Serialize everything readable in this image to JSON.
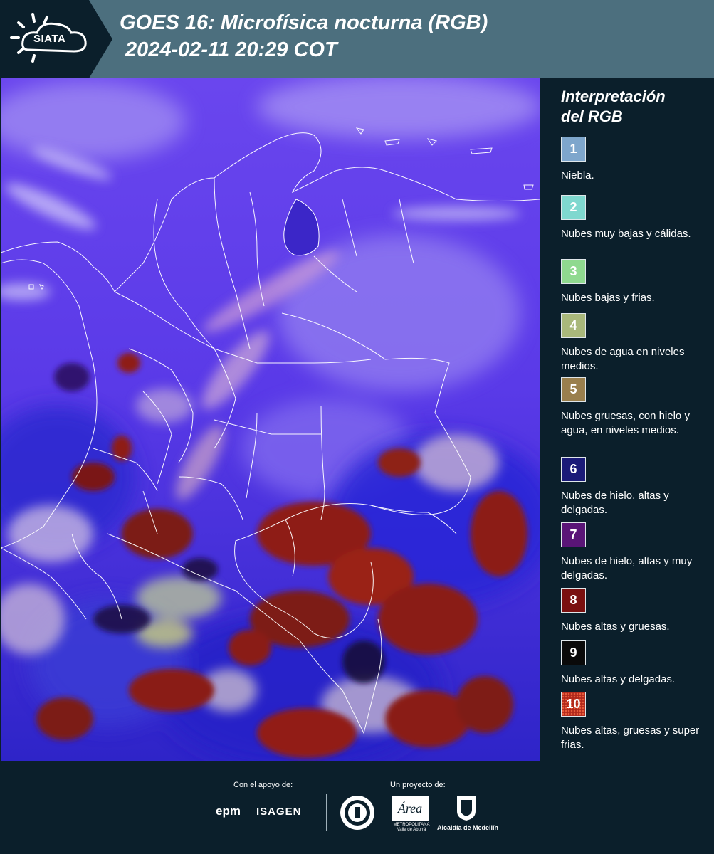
{
  "header": {
    "logo_text": "SIATA",
    "title": "GOES 16: Microfísica nocturna (RGB)",
    "subtitle": "2024-02-11 20:29 COT"
  },
  "legend": {
    "title_line1": "Interpretación",
    "title_line2": "del RGB",
    "items": [
      {
        "number": "1",
        "color": "#7ea6cc",
        "label": "Niebla."
      },
      {
        "number": "2",
        "color": "#7fd8cf",
        "label": "Nubes muy bajas y cálidas."
      },
      {
        "number": "3",
        "color": "#8fd98f",
        "label": "Nubes bajas y frias."
      },
      {
        "number": "4",
        "color": "#a9b87b",
        "label": "Nubes de agua en niveles medios."
      },
      {
        "number": "5",
        "color": "#9a7f4d",
        "label": "Nubes gruesas, con hielo y agua, en niveles medios."
      },
      {
        "number": "6",
        "color": "#1a1a78",
        "label": "Nubes de hielo, altas y delgadas."
      },
      {
        "number": "7",
        "color": "#5a1577",
        "label": "Nubes de hielo, altas y muy delgadas."
      },
      {
        "number": "8",
        "color": "#7a1010",
        "label": "Nubes altas y gruesas."
      },
      {
        "number": "9",
        "color": "#0a0a0a",
        "label": "Nubes altas y delgadas."
      },
      {
        "number": "10",
        "color": "#b0281c",
        "label": "Nubes altas, gruesas y super frias."
      }
    ]
  },
  "footer": {
    "support_label": "Con el apoyo de:",
    "project_label": "Un proyecto de:",
    "epm": "epm",
    "isagen": "ISAGEN",
    "area_label": "METROPOLITANA Valle de Aburrá",
    "alcaldia_label": "Alcaldía de Medellín"
  }
}
